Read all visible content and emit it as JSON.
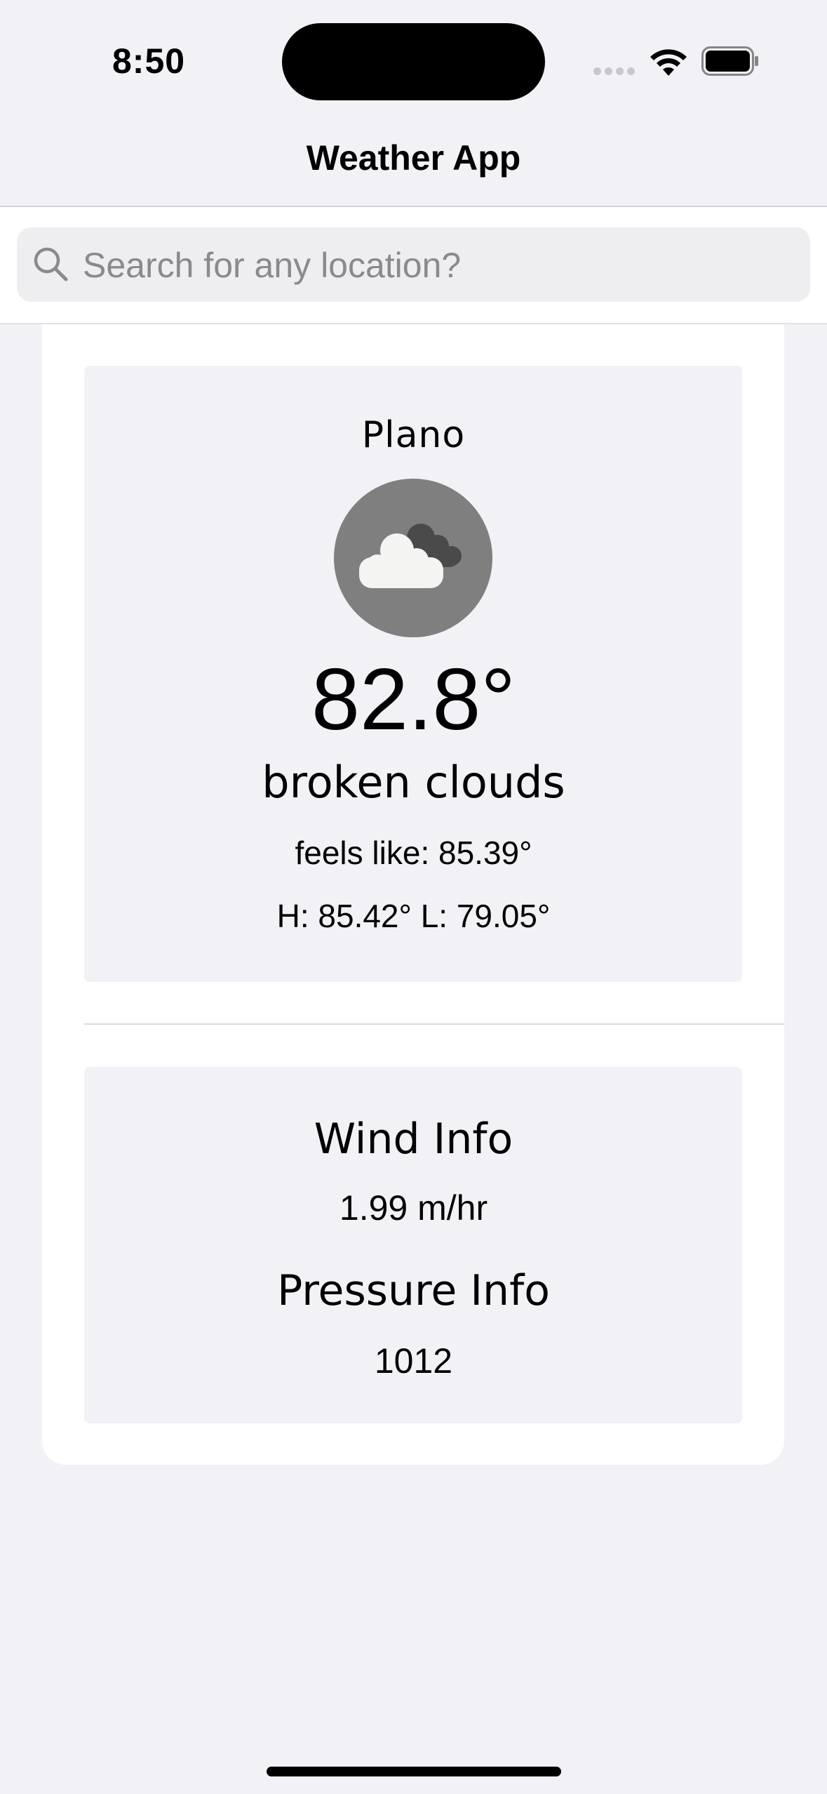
{
  "status_bar": {
    "time": "8:50"
  },
  "nav": {
    "title": "Weather App"
  },
  "search": {
    "placeholder": "Search for any location?",
    "value": ""
  },
  "weather": {
    "city": "Plano",
    "icon": "broken-clouds-icon",
    "temperature": "82.8°",
    "description": "broken clouds",
    "feels_like": "feels like: 85.39°",
    "high_low": "H: 85.42° L: 79.05°"
  },
  "details": {
    "wind_title": "Wind Info",
    "wind_value": "1.99 m/hr",
    "pressure_title": "Pressure Info",
    "pressure_value": "1012"
  }
}
